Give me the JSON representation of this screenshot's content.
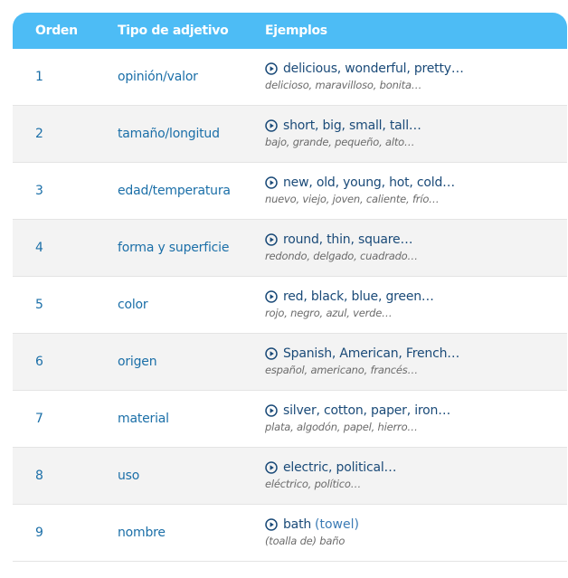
{
  "header": {
    "col_order": "Orden",
    "col_type": "Tipo de adjetivo",
    "col_examples": "Ejemplos"
  },
  "rows": [
    {
      "num": "1",
      "type": "opinión/valor",
      "en": "delicious, wonderful, pretty…",
      "es": "delicioso, maravilloso, bonita…"
    },
    {
      "num": "2",
      "type": "tamaño/longitud",
      "en": "short, big, small, tall…",
      "es": "bajo, grande, pequeño, alto…"
    },
    {
      "num": "3",
      "type": "edad/temperatura",
      "en": "new, old, young, hot, cold…",
      "es": "nuevo, viejo, joven, caliente, frío…"
    },
    {
      "num": "4",
      "type": "forma y superficie",
      "en": "round, thin, square…",
      "es": "redondo, delgado, cuadrado…"
    },
    {
      "num": "5",
      "type": "color",
      "en": "red, black, blue, green…",
      "es": "rojo, negro, azul, verde…"
    },
    {
      "num": "6",
      "type": "origen",
      "en": "Spanish, American, French…",
      "es": "español, americano, francés…"
    },
    {
      "num": "7",
      "type": "material",
      "en": "silver, cotton, paper, iron…",
      "es": "plata, algodón, papel, hierro…"
    },
    {
      "num": "8",
      "type": "uso",
      "en": "electric, political…",
      "es": "eléctrico, político…"
    },
    {
      "num": "9",
      "type": "nombre",
      "en": "bath",
      "en_extra": "(towel)",
      "es": "(toalla de) baño"
    }
  ],
  "colors": {
    "header_bg": "#4dbcf5",
    "link_blue": "#1b6fa8",
    "example_blue": "#1a4a78"
  }
}
